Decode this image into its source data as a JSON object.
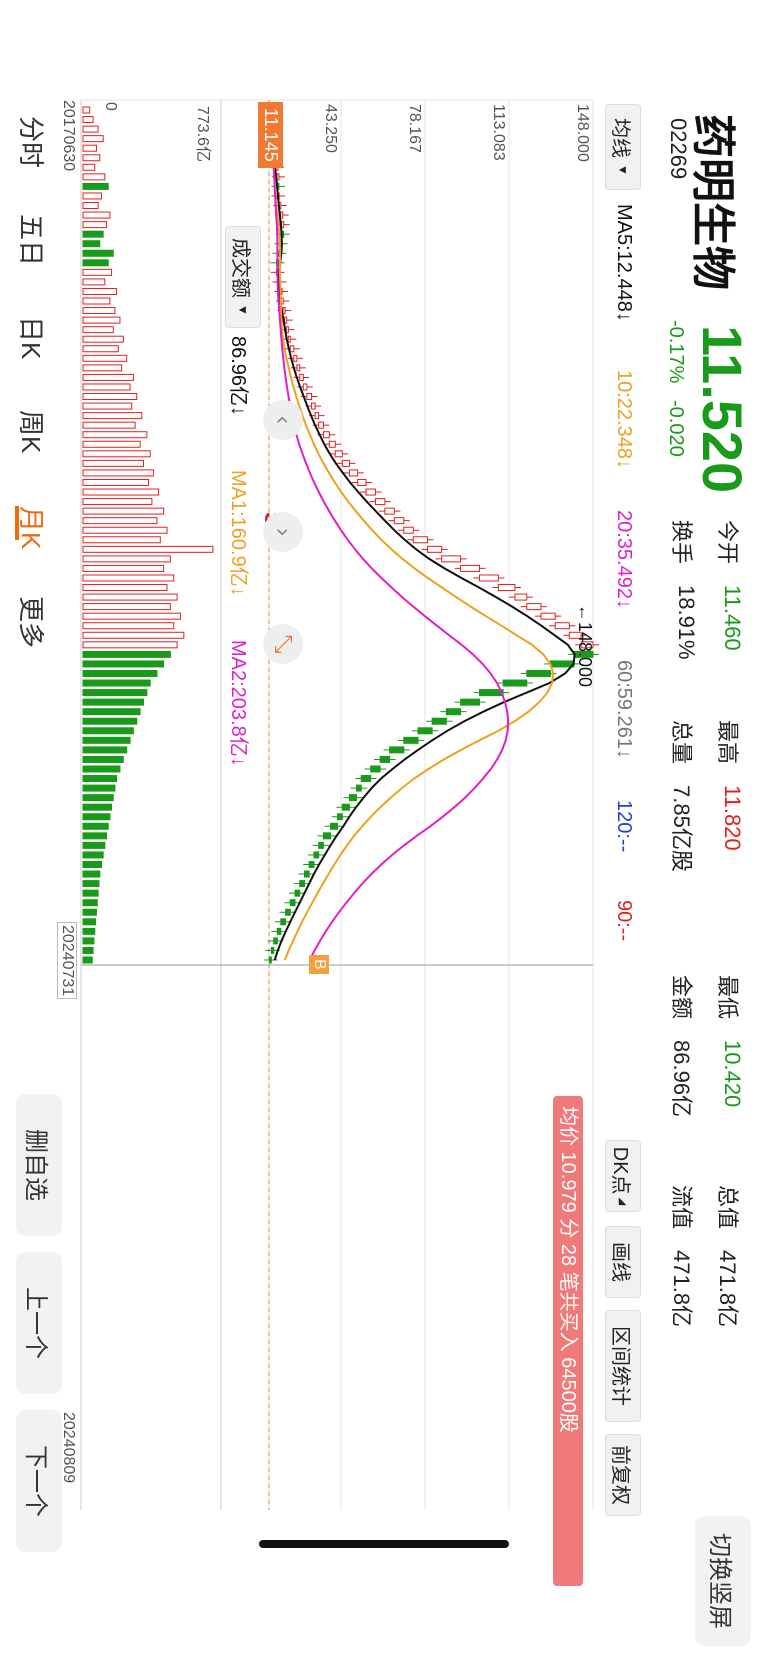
{
  "header": {
    "stock_name": "药明生物",
    "stock_code": "02269",
    "price": "11.520",
    "change_pct": "-0.17%",
    "change_abs": "-0.020",
    "switch_label": "切换竖屏"
  },
  "quote": {
    "open_label": "今开",
    "open_value": "11.460",
    "high_label": "最高",
    "high_value": "11.820",
    "low_label": "最低",
    "low_value": "10.420",
    "cap_label": "总值",
    "cap_value": "471.8亿",
    "turnover_label": "换手",
    "turnover_value": "18.91%",
    "volume_label": "总量",
    "volume_value": "7.85亿股",
    "amount_label": "金额",
    "amount_value": "86.96亿",
    "float_label": "流值",
    "float_value": "471.8亿"
  },
  "ma_bar": {
    "selector_label": "均线",
    "ma5": "MA5:12.448↓",
    "ma10": "10:22.348↓",
    "ma20": "20:35.492↓",
    "ma60": "60:59.261↓",
    "ma120": "120:--",
    "ma90": "90:--",
    "colors": {
      "ma5": "#111111",
      "ma10": "#f0a020",
      "ma20": "#e020c8",
      "ma60": "#777777",
      "ma120": "#2040d0",
      "ma90": "#e02020"
    }
  },
  "tools": {
    "dk_label": "DK点",
    "draw_label": "画线",
    "range_label": "区间统计",
    "adjust_label": "前复权"
  },
  "banner": {
    "text": "均价 10.979 分 28 笔共买入 64500股"
  },
  "price_axis": [
    "148.000",
    "113.083",
    "78.167",
    "43.250"
  ],
  "chart_labels": {
    "high_marker": "←148.000",
    "current_tag": "11.145",
    "sell_marker": "S",
    "buy_marker": "B"
  },
  "volume_bar": {
    "selector_label": "成交额",
    "current": "86.96亿↓",
    "ma1": "MA1:160.9亿↓",
    "ma2": "MA2:203.8亿↓",
    "axis_top": "773.6亿",
    "axis_zero": "0"
  },
  "dates": {
    "start": "20170630",
    "cross": "20240731",
    "end": "20240809"
  },
  "periods": [
    "分时",
    "五日",
    "日K",
    "周K",
    "月K",
    "更多"
  ],
  "active_period": "月K",
  "side_buttons": {
    "delete": "删自选",
    "prev": "上一个",
    "next": "下一个"
  },
  "chart_data": {
    "type": "candlestick",
    "period": "monthly",
    "x_start": "20170630",
    "x_end": "20240809",
    "ylim": [
      11.0,
      148.0
    ],
    "price_ticks": [
      148.0,
      113.083,
      78.167,
      43.25
    ],
    "candles": [
      11.5,
      11.8,
      12.2,
      12.9,
      13.5,
      14.1,
      14.8,
      15.2,
      14.6,
      15.3,
      16.0,
      16.8,
      17.2,
      16.4,
      15.8,
      15.0,
      14.2,
      15.0,
      15.8,
      16.5,
      17.0,
      17.8,
      18.5,
      19.2,
      20.0,
      21.5,
      22.8,
      24.0,
      25.5,
      27.0,
      29.0,
      30.5,
      32.0,
      34.0,
      36.5,
      39.0,
      42.0,
      45.0,
      48.5,
      52.0,
      56.0,
      60.0,
      64.0,
      68.0,
      72.0,
      78.0,
      84.0,
      92.0,
      100.0,
      108.0,
      115.0,
      120.0,
      126.0,
      132.0,
      138.0,
      143.0,
      148.0,
      140.0,
      130.0,
      120.0,
      110.0,
      100.0,
      92.0,
      86.0,
      80.0,
      74.0,
      68.0,
      62.0,
      58.0,
      54.0,
      50.0,
      48.0,
      45.0,
      42.0,
      40.0,
      37.0,
      34.0,
      32.0,
      30.0,
      28.0,
      26.0,
      24.0,
      22.0,
      20.0,
      18.0,
      16.0,
      14.5,
      13.0,
      12.0,
      11.5
    ],
    "volume_ylim": [
      0,
      773.6
    ],
    "volumes": [
      40,
      60,
      90,
      120,
      80,
      100,
      70,
      130,
      150,
      110,
      90,
      160,
      140,
      120,
      100,
      180,
      150,
      170,
      130,
      200,
      160,
      190,
      220,
      180,
      240,
      210,
      260,
      230,
      300,
      280,
      320,
      290,
      350,
      310,
      380,
      340,
      400,
      360,
      420,
      390,
      450,
      410,
      480,
      440,
      500,
      460,
      773,
      520,
      480,
      540,
      500,
      560,
      520,
      580,
      540,
      600,
      560,
      520,
      480,
      440,
      400,
      380,
      360,
      340,
      320,
      300,
      280,
      260,
      240,
      220,
      200,
      190,
      180,
      170,
      160,
      150,
      140,
      130,
      120,
      110,
      100,
      95,
      90,
      85,
      80,
      75,
      70,
      65,
      60,
      55
    ],
    "series": [
      {
        "name": "MA5",
        "values": [
          12.448
        ]
      },
      {
        "name": "10",
        "values": [
          22.348
        ]
      },
      {
        "name": "20",
        "values": [
          35.492
        ]
      },
      {
        "name": "60",
        "values": [
          59.261
        ]
      }
    ]
  }
}
